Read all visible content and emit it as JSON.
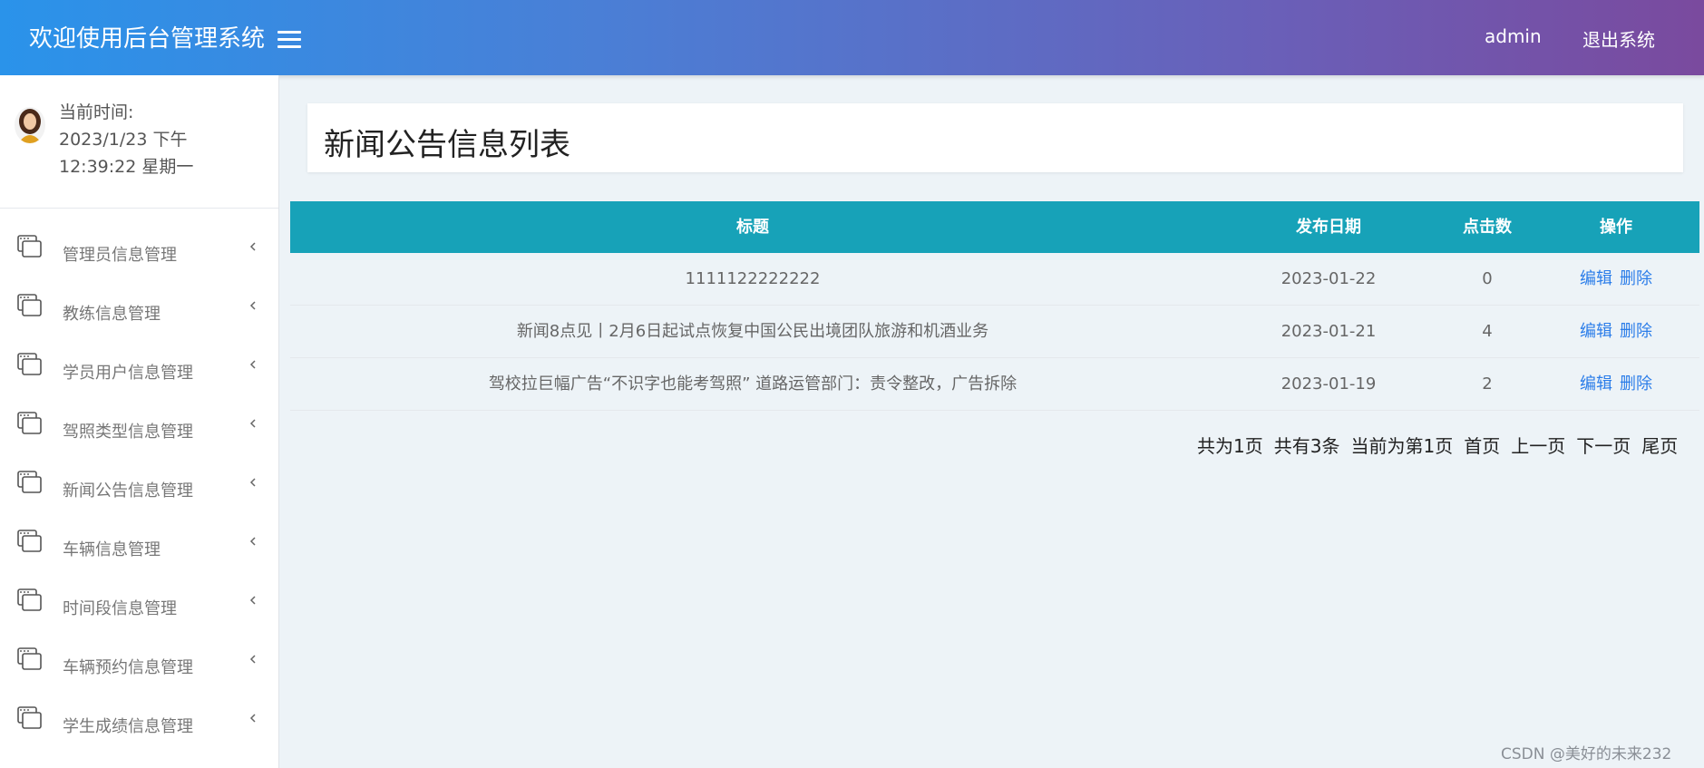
{
  "header": {
    "brand": "欢迎使用后台管理系统",
    "user": "admin",
    "logout": "退出系统"
  },
  "profile": {
    "time_label": "当前时间:",
    "date_line": "2023/1/23 下午",
    "time_line": "12:39:22 星期一"
  },
  "sidebar": {
    "items": [
      {
        "label": "管理员信息管理"
      },
      {
        "label": "教练信息管理"
      },
      {
        "label": "学员用户信息管理"
      },
      {
        "label": "驾照类型信息管理"
      },
      {
        "label": "新闻公告信息管理"
      },
      {
        "label": "车辆信息管理"
      },
      {
        "label": "时间段信息管理"
      },
      {
        "label": "车辆预约信息管理"
      },
      {
        "label": "学生成绩信息管理"
      }
    ]
  },
  "main": {
    "title": "新闻公告信息列表",
    "table": {
      "headers": {
        "title": "标题",
        "date": "发布日期",
        "clicks": "点击数",
        "ops": "操作"
      },
      "rows": [
        {
          "title": "1111122222222",
          "date": "2023-01-22",
          "clicks": "0",
          "edit": "编辑",
          "delete": "删除"
        },
        {
          "title": "新闻8点见丨2月6日起试点恢复中国公民出境团队旅游和机酒业务",
          "date": "2023-01-21",
          "clicks": "4",
          "edit": "编辑",
          "delete": "删除"
        },
        {
          "title": "驾校拉巨幅广告“不识字也能考驾照” 道路运管部门：责令整改，广告拆除",
          "date": "2023-01-19",
          "clicks": "2",
          "edit": "编辑",
          "delete": "删除"
        }
      ]
    },
    "pager": {
      "total_pages": "共为1页",
      "total_items": "共有3条",
      "current": "当前为第1页",
      "first": "首页",
      "prev": "上一页",
      "next": "下一页",
      "last": "尾页"
    }
  },
  "watermark": "CSDN @美好的未来232",
  "colors": {
    "header_gradient_start": "#2a93ea",
    "header_gradient_end": "#7a4a9e",
    "table_header": "#17a2b8",
    "link": "#2b7de9",
    "background": "#edf3f7"
  },
  "icons": {
    "menu_toggle": "hamburger-icon",
    "menu_item": "window-icon",
    "menu_chevron": "chevron-left-icon"
  }
}
